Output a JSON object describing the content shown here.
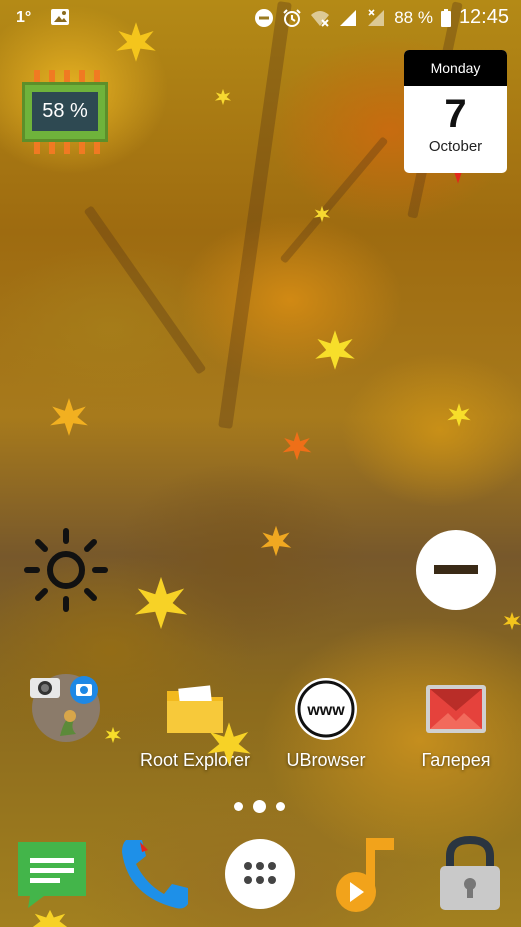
{
  "status_bar": {
    "temperature": "1°",
    "battery_percent": "88 %",
    "time": "12:45"
  },
  "battery_widget": {
    "value": "58 %"
  },
  "calendar_widget": {
    "weekday": "Monday",
    "day": "7",
    "month": "October"
  },
  "apps": [
    {
      "label": ""
    },
    {
      "label": "Root Explorer"
    },
    {
      "label": "UBrowser"
    },
    {
      "label": "Галерея"
    }
  ],
  "browser_icon_text": "www",
  "page_indicator": {
    "pages": 3,
    "current": 2
  },
  "colors": {
    "battery_green": "#6fb33b",
    "battery_screen": "#2e4952",
    "calendar_header": "#000000",
    "messages_green": "#43b54a",
    "phone_blue": "#1e90e8",
    "music_orange": "#f2a31b",
    "lock_gray": "#c9c9c9",
    "gallery_red": "#e5423c"
  },
  "dock": [
    "messages-icon",
    "phone-icon",
    "app-drawer-icon",
    "music-icon",
    "lock-icon"
  ]
}
